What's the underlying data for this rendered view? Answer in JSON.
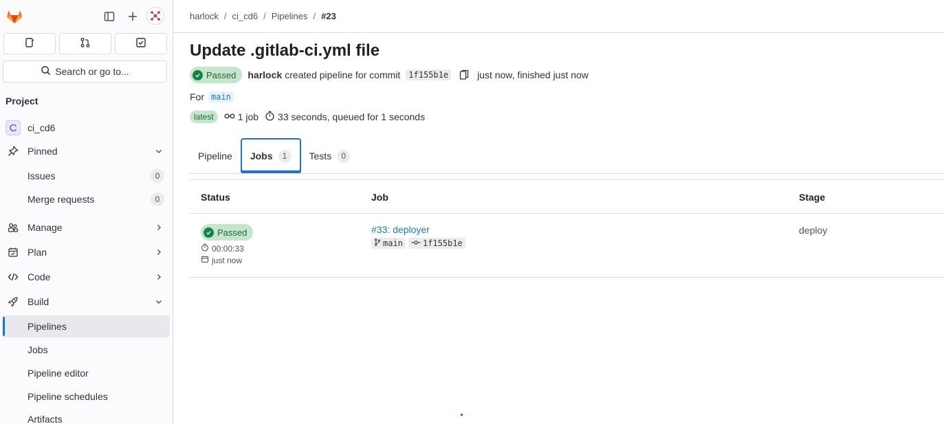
{
  "sidebar": {
    "search_label": "Search or go to...",
    "section_title": "Project",
    "project_initial": "C",
    "project_name": "ci_cd6",
    "pinned_label": "Pinned",
    "pinned_items": [
      {
        "label": "Issues",
        "count": "0"
      },
      {
        "label": "Merge requests",
        "count": "0"
      }
    ],
    "groups": [
      {
        "label": "Manage"
      },
      {
        "label": "Plan"
      },
      {
        "label": "Code"
      },
      {
        "label": "Build"
      }
    ],
    "build_items": [
      {
        "label": "Pipelines",
        "active": true
      },
      {
        "label": "Jobs"
      },
      {
        "label": "Pipeline editor"
      },
      {
        "label": "Pipeline schedules"
      },
      {
        "label": "Artifacts"
      }
    ]
  },
  "breadcrumb": [
    "harlock",
    "ci_cd6",
    "Pipelines",
    "#23"
  ],
  "pipeline": {
    "title": "Update .gitlab-ci.yml file",
    "status": "Passed",
    "author": "harlock",
    "created_text": "created pipeline for commit",
    "commit": "1f155b1e",
    "time_text": "just now, finished just now",
    "for_label": "For",
    "ref": "main",
    "latest_label": "latest",
    "jobs_text": "1 job",
    "duration_text": "33 seconds, queued for 1 seconds"
  },
  "tabs": [
    {
      "label": "Pipeline"
    },
    {
      "label": "Jobs",
      "count": "1"
    },
    {
      "label": "Tests",
      "count": "0"
    }
  ],
  "table": {
    "headers": [
      "Status",
      "Job",
      "Stage"
    ],
    "rows": [
      {
        "status": "Passed",
        "duration": "00:00:33",
        "finished": "just now",
        "job": "#33: deployer",
        "ref": "main",
        "commit": "1f155b1e",
        "stage": "deploy"
      }
    ]
  },
  "colors": {
    "accent": "#1f75cb",
    "success": "#108548",
    "success_bg": "#c3e6cd"
  }
}
